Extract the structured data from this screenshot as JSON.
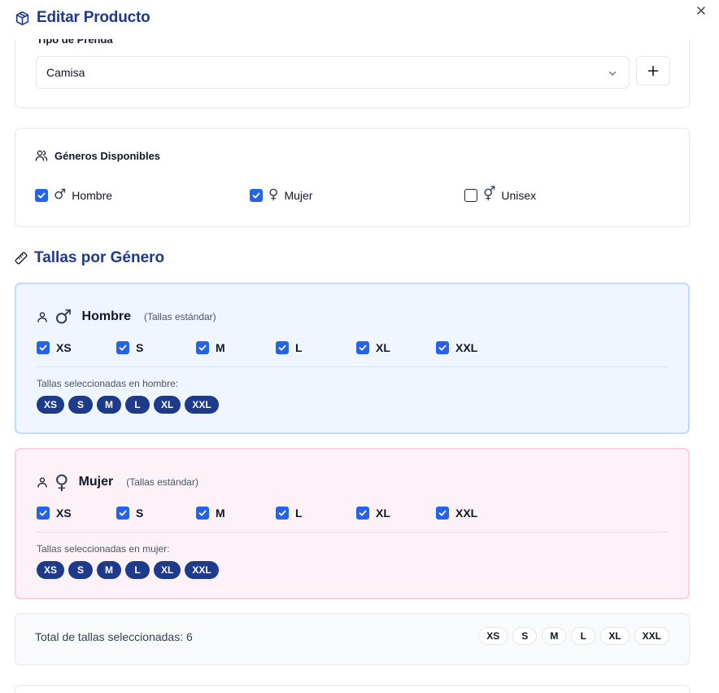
{
  "dialog": {
    "title": "Editar Producto",
    "close_label": "×"
  },
  "tipo_prenda": {
    "label": "Tipo de Prenda",
    "selected": "Camisa",
    "add_label": "+"
  },
  "generos": {
    "title": "Géneros Disponibles",
    "options": [
      {
        "label": "Hombre",
        "symbol": "♂",
        "checked": true
      },
      {
        "label": "Mujer",
        "symbol": "♀",
        "checked": true
      },
      {
        "label": "Unisex",
        "symbol": "⚥",
        "checked": false
      }
    ]
  },
  "tallas": {
    "title": "Tallas por Género",
    "groups": [
      {
        "name": "Hombre",
        "symbol": "♂",
        "subtitle": "(Tallas estándar)",
        "sizes": [
          "XS",
          "S",
          "M",
          "L",
          "XL",
          "XXL"
        ],
        "selected_label": "Tallas seleccionadas en hombre:",
        "selected": [
          "XS",
          "S",
          "M",
          "L",
          "XL",
          "XXL"
        ]
      },
      {
        "name": "Mujer",
        "symbol": "♀",
        "subtitle": "(Tallas estándar)",
        "sizes": [
          "XS",
          "S",
          "M",
          "L",
          "XL",
          "XXL"
        ],
        "selected_label": "Tallas seleccionadas en mujer:",
        "selected": [
          "XS",
          "S",
          "M",
          "L",
          "XL",
          "XXL"
        ]
      }
    ]
  },
  "total": {
    "text": "Total de tallas seleccionadas: 6",
    "sizes": [
      "XS",
      "S",
      "M",
      "L",
      "XL",
      "XXL"
    ]
  },
  "colors": {
    "primary": "#1e3a8a",
    "checkbox": "#2563eb",
    "male_bg": "#eff6ff",
    "female_bg": "#fdf2f8"
  }
}
